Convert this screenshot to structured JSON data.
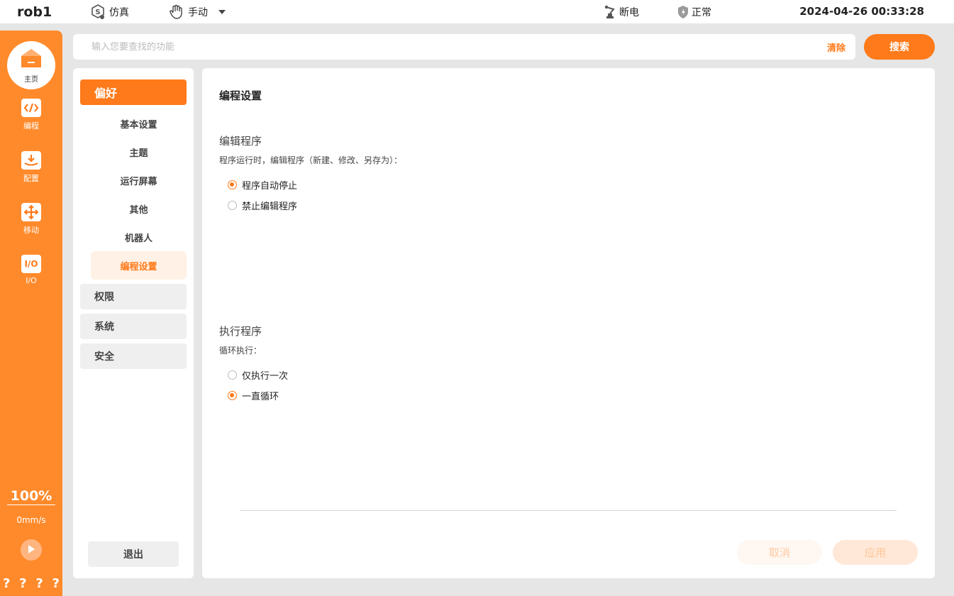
{
  "topbar": {
    "robot_name": "rob1",
    "mode_sim": "仿真",
    "mode_manual": "手动",
    "power": "断电",
    "state": "正常",
    "datetime": "2024-04-26 00:33:28"
  },
  "sidebar": {
    "home": "主页",
    "items": [
      {
        "label": "编程",
        "icon": "code-icon"
      },
      {
        "label": "配置",
        "icon": "download-icon"
      },
      {
        "label": "移动",
        "icon": "move-icon"
      },
      {
        "label": "I/O",
        "icon": "io-icon",
        "glyph": "I/O"
      }
    ],
    "speed_percent": "100%",
    "speed_value": "0mm/s",
    "qmarks": [
      "?",
      "?",
      "?",
      "?"
    ]
  },
  "search": {
    "placeholder": "输入您要查找的功能",
    "clear": "清除",
    "button": "搜索"
  },
  "categories": {
    "preference": "偏好",
    "sub_items": [
      "基本设置",
      "主题",
      "运行屏幕",
      "其他",
      "机器人",
      "编程设置"
    ],
    "selected_sub": "编程设置",
    "permissions": "权限",
    "system": "系统",
    "safety": "安全",
    "logout": "退出"
  },
  "main": {
    "title": "编程设置",
    "edit_section": {
      "title": "编辑程序",
      "desc": "程序运行时，编辑程序（新建、修改、另存为）：",
      "options": [
        "程序自动停止",
        "禁止编辑程序"
      ],
      "selected": 0
    },
    "exec_section": {
      "title": "执行程序",
      "desc": "循环执行：",
      "options": [
        "仅执行一次",
        "一直循环"
      ],
      "selected": 1
    },
    "cancel": "取消",
    "apply": "应用"
  },
  "colors": {
    "accent": "#ff7a1a",
    "sidebar": "#ff8a2b"
  }
}
